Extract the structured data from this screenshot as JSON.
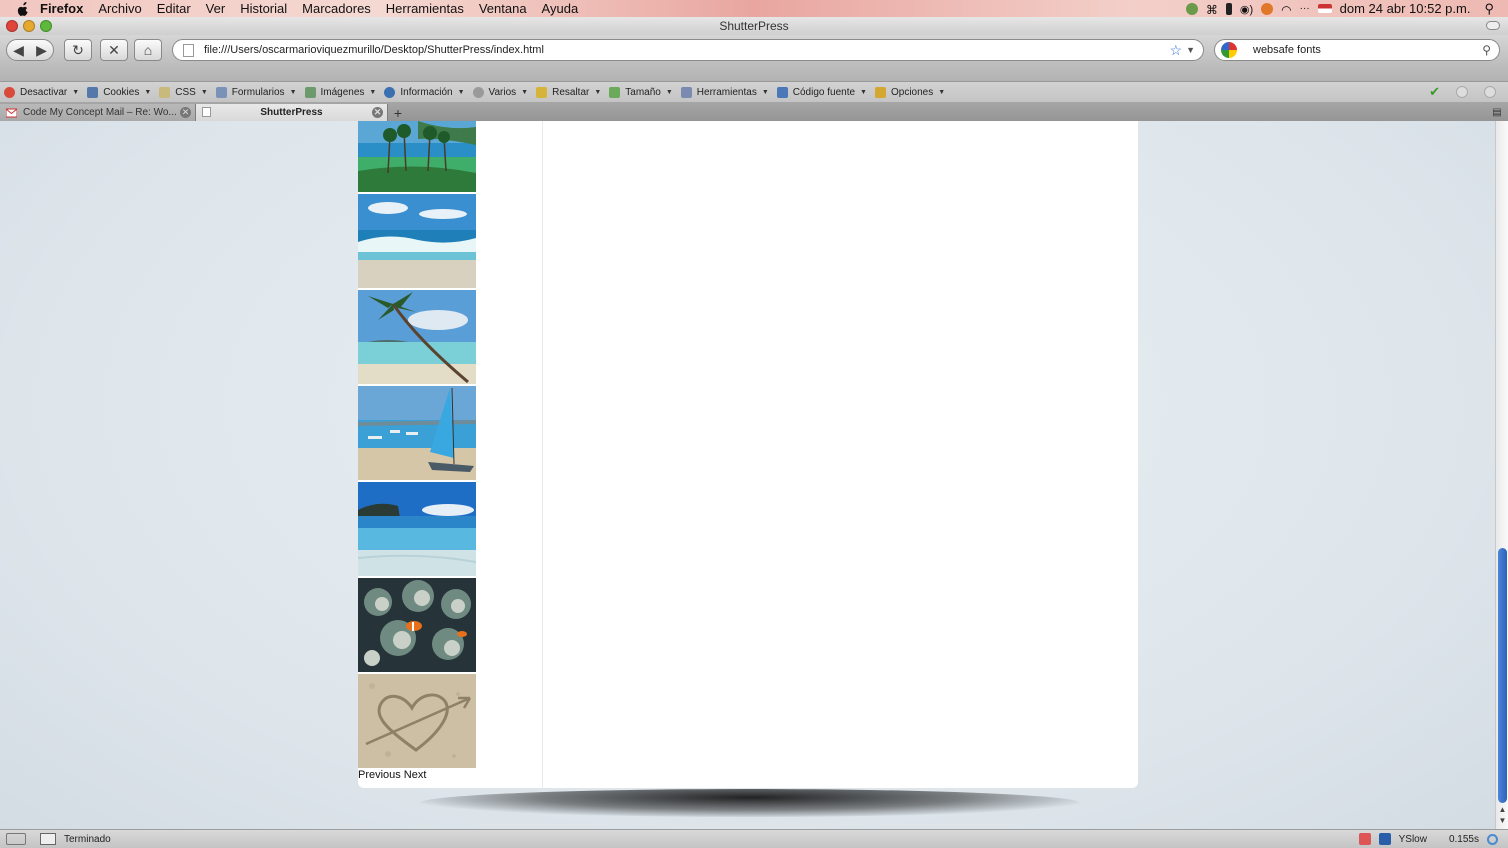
{
  "menubar": {
    "app": "Firefox",
    "items": [
      "Archivo",
      "Editar",
      "Ver",
      "Historial",
      "Marcadores",
      "Herramientas",
      "Ventana",
      "Ayuda"
    ],
    "clock": "dom 24 abr  10:52 p.m."
  },
  "window": {
    "title": "ShutterPress"
  },
  "navbar": {
    "url": "file:///Users/oscarmarioviquezmurillo/Desktop/ShutterPress/index.html",
    "search_value": "websafe fonts"
  },
  "devbar": {
    "items": [
      {
        "label": "Desactivar",
        "icon": "disable-icon",
        "color": "#d84a3a"
      },
      {
        "label": "Cookies",
        "icon": "cookies-icon",
        "color": "#5577aa"
      },
      {
        "label": "CSS",
        "icon": "css-icon",
        "color": "#c9b97a"
      },
      {
        "label": "Formularios",
        "icon": "forms-icon",
        "color": "#7a92b8"
      },
      {
        "label": "Imágenes",
        "icon": "images-icon",
        "color": "#6c9a6c"
      },
      {
        "label": "Información",
        "icon": "info-icon",
        "color": "#3a6fb0"
      },
      {
        "label": "Varios",
        "icon": "misc-icon",
        "color": "#9a9a9a"
      },
      {
        "label": "Resaltar",
        "icon": "highlight-icon",
        "color": "#d6b43a"
      },
      {
        "label": "Tamaño",
        "icon": "resize-icon",
        "color": "#6aaa5a"
      },
      {
        "label": "Herramientas",
        "icon": "tools-icon",
        "color": "#7a8ab0"
      },
      {
        "label": "Código fuente",
        "icon": "source-icon",
        "color": "#4a78b8"
      },
      {
        "label": "Opciones",
        "icon": "options-icon",
        "color": "#d4a830"
      }
    ]
  },
  "tabs": [
    {
      "label": "Code My Concept Mail – Re: Wo...",
      "active": false
    },
    {
      "label": "ShutterPress",
      "active": true
    }
  ],
  "gallery": {
    "thumbnails": [
      {
        "name": "palm-coast-thumbnail",
        "colors": [
          "#1f8ac0",
          "#3fae6a",
          "#2e7a3a"
        ]
      },
      {
        "name": "wave-beach-thumbnail",
        "colors": [
          "#3a8fd0",
          "#6cc3d6",
          "#d8d1c0"
        ]
      },
      {
        "name": "leaning-palm-thumbnail",
        "colors": [
          "#5a9ed8",
          "#7bcfd6",
          "#e3dcc6"
        ]
      },
      {
        "name": "sailboat-beach-thumbnail",
        "colors": [
          "#6aa6d6",
          "#3aa0d6",
          "#d4c6a6"
        ]
      },
      {
        "name": "lagoon-thumbnail",
        "colors": [
          "#1f6ec6",
          "#58b8e0",
          "#cfe2e6"
        ]
      },
      {
        "name": "coral-reef-thumbnail",
        "colors": [
          "#26343a",
          "#6f8a80",
          "#c9d0c8"
        ]
      },
      {
        "name": "sand-heart-thumbnail",
        "colors": [
          "#cdbfa4",
          "#b9ab8f",
          "#a89a7e"
        ]
      }
    ],
    "previous_label": "Previous",
    "next_label": "Next"
  },
  "statusbar": {
    "status": "Terminado",
    "yslow": "YSlow",
    "timing": "0.155s"
  }
}
